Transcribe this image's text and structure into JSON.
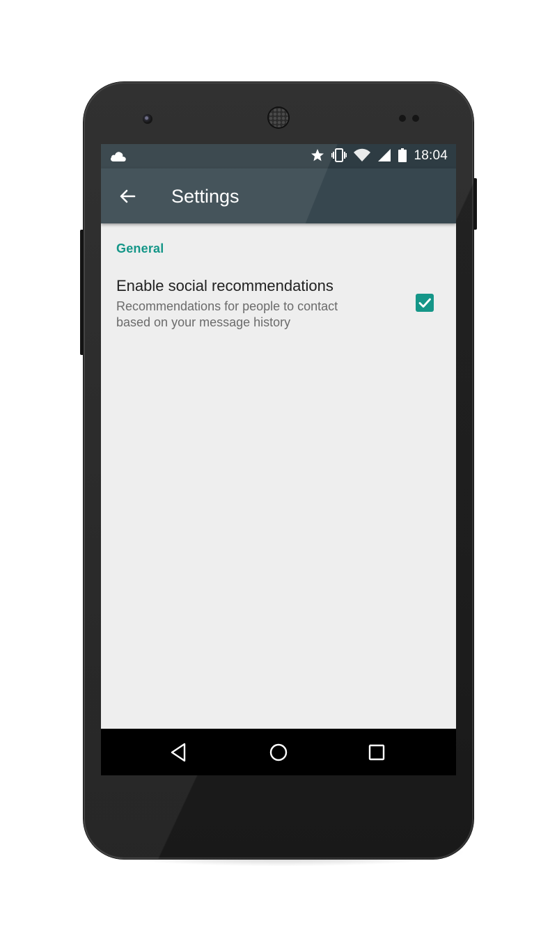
{
  "status_bar": {
    "time": "18:04",
    "icons": [
      "cloud-icon",
      "star-icon",
      "vibrate-icon",
      "wifi-icon",
      "cell-signal-icon",
      "battery-icon"
    ]
  },
  "app_bar": {
    "title": "Settings",
    "back_icon": "arrow-back-icon"
  },
  "section": {
    "header": "General"
  },
  "preference": {
    "title": "Enable social recommendations",
    "summary_line1": "Recommendations for people to contact",
    "summary_line2": "based on your message history",
    "checked": true
  },
  "nav_bar": {
    "icons": [
      "back-triangle-icon",
      "home-circle-icon",
      "recents-square-icon"
    ]
  },
  "colors": {
    "status_bar": "#2e3c43",
    "app_bar": "#37474f",
    "accent": "#159688",
    "background": "#eeeeee"
  }
}
